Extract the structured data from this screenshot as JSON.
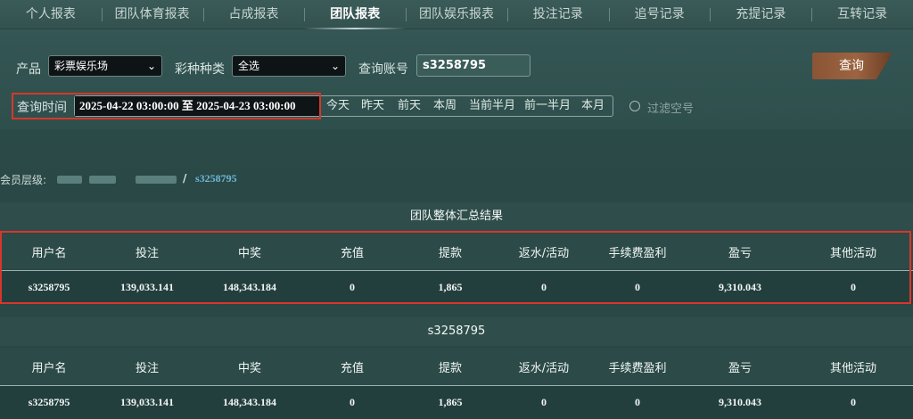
{
  "tabs": [
    "个人报表",
    "团队体育报表",
    "占成报表",
    "团队报表",
    "团队娱乐报表",
    "投注记录",
    "追号记录",
    "充提记录",
    "互转记录"
  ],
  "active_tab": "团队报表",
  "filters": {
    "product_label": "产品",
    "product_value": "彩票娱乐场",
    "category_label": "彩种种类",
    "category_value": "全选",
    "account_label": "查询账号",
    "account_value": "s3258795",
    "query_button": "查询",
    "time_label": "查询时间",
    "time_range": "2025-04-22 03:00:00 至 2025-04-23 03:00:00",
    "quick_ranges": [
      "今天",
      "昨天",
      "前天",
      "本周",
      "当前半月",
      "前一半月",
      "本月"
    ],
    "filter_empty_label": "过滤空号"
  },
  "breadcrumb": {
    "label": "会员层级:",
    "separator": "/",
    "current": "s3258795"
  },
  "summary": {
    "title": "团队整体汇总结果",
    "columns": [
      "用户名",
      "投注",
      "中奖",
      "充值",
      "提款",
      "返水/活动",
      "手续费盈利",
      "盈亏",
      "其他活动"
    ],
    "row": [
      "s3258795",
      "139,033.141",
      "148,343.184",
      "0",
      "1,865",
      "0",
      "0",
      "9,310.043",
      "0"
    ]
  },
  "detail": {
    "title": "s3258795",
    "columns": [
      "用户名",
      "投注",
      "中奖",
      "充值",
      "提款",
      "返水/活动",
      "手续费盈利",
      "盈亏",
      "其他活动"
    ],
    "row": [
      "s3258795",
      "139,033.141",
      "148,343.184",
      "0",
      "1,865",
      "0",
      "0",
      "9,310.043",
      "0"
    ]
  },
  "colors": {
    "highlight": "#d9362b",
    "link": "#6fb7d6",
    "button": "#9c6440"
  }
}
